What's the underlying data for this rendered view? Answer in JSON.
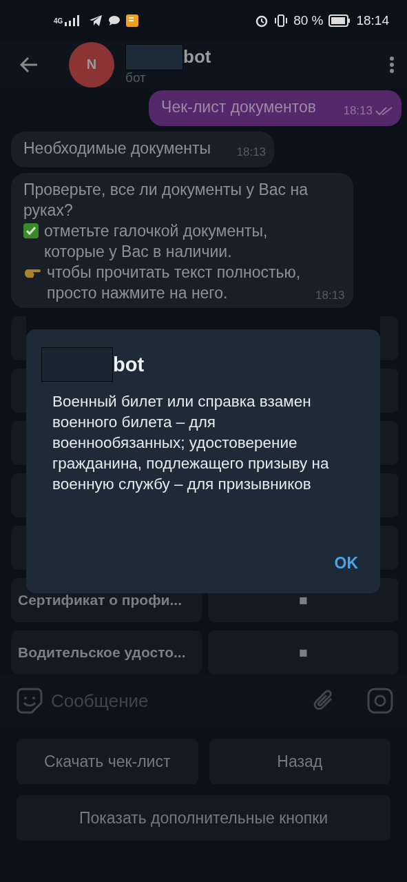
{
  "status_bar": {
    "network": "4G",
    "battery": "80 %",
    "time": "18:14"
  },
  "header": {
    "avatar_letter": "N",
    "title": "bot",
    "title_redacted": true,
    "subtitle": "бот"
  },
  "messages": [
    {
      "kind": "outgoing",
      "text": "Чек-лист документов",
      "time": "18:13",
      "read": true
    },
    {
      "kind": "incoming",
      "text": "Необходимые документы",
      "time": "18:13"
    },
    {
      "kind": "incoming",
      "lines": [
        {
          "kind": "plain",
          "text": "Проверьте, все ли документы у Вас на руках?"
        },
        {
          "kind": "checked-note",
          "text": "отметьте галочкой документы, которые у Вас в наличии."
        },
        {
          "kind": "tap-note",
          "text": "чтобы прочитать текст полностью, просто нажмите на него."
        }
      ],
      "time": "18:13"
    }
  ],
  "inline_keyboard": [
    {
      "kind": "covered"
    },
    {
      "kind": "covered"
    },
    {
      "kind": "covered"
    },
    {
      "kind": "covered"
    },
    {
      "kind": "covered"
    },
    {
      "kind": "button-pair",
      "label": "Сертификат о профи...",
      "value": "■"
    },
    {
      "kind": "button-pair",
      "label": "Водительское удосто...",
      "value": "■"
    }
  ],
  "dialog": {
    "title": "bot",
    "title_redacted": true,
    "text": "Военный билет или справка взамен военного билета – для военнообязанных; удостоверение гражданина, подлежащего призыву на военную службу – для призывников",
    "button": "OK"
  },
  "composer": {
    "placeholder": "Сообщение"
  },
  "reply_keyboard": [
    [
      "Скачать чек-лист",
      "Назад"
    ],
    [
      "Показать дополнительные кнопки"
    ]
  ]
}
